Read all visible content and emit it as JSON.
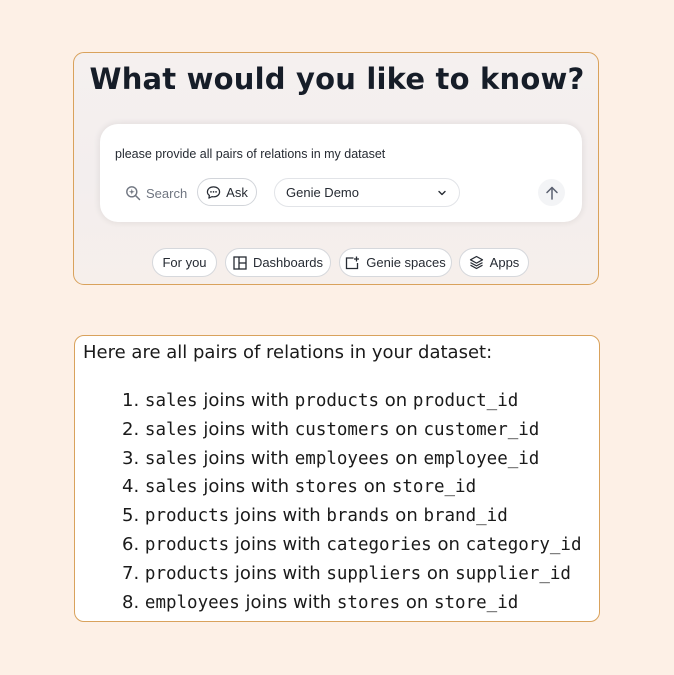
{
  "prompt": {
    "title": "What would you like to know?",
    "query": "please provide all pairs of relations in my dataset",
    "search_label": "Search",
    "ask_label": "Ask",
    "space_selected": "Genie Demo"
  },
  "chips": [
    {
      "label": "For you"
    },
    {
      "label": "Dashboards",
      "icon": "dashboard-grid-icon"
    },
    {
      "label": "Genie spaces",
      "icon": "genie-space-icon"
    },
    {
      "label": "Apps",
      "icon": "layers-icon"
    }
  ],
  "answer": {
    "intro": "Here are all pairs of relations in your dataset:",
    "join_word": " joins with ",
    "on_word": " on ",
    "relations": [
      {
        "num": "1. ",
        "left": "sales",
        "right": "products",
        "key": "product_id"
      },
      {
        "num": "2. ",
        "left": "sales",
        "right": "customers",
        "key": "customer_id"
      },
      {
        "num": "3. ",
        "left": "sales",
        "right": "employees",
        "key": "employee_id"
      },
      {
        "num": "4. ",
        "left": "sales",
        "right": "stores",
        "key": "store_id"
      },
      {
        "num": "5. ",
        "left": "products",
        "right": "brands",
        "key": "brand_id"
      },
      {
        "num": "6. ",
        "left": "products",
        "right": "categories",
        "key": "category_id"
      },
      {
        "num": "7. ",
        "left": "products",
        "right": "suppliers",
        "key": "supplier_id"
      },
      {
        "num": "8. ",
        "left": "employees",
        "right": "stores",
        "key": "store_id"
      }
    ]
  },
  "colors": {
    "background": "#fdf0e6",
    "card_border": "#d9a25c",
    "text": "#161d28"
  }
}
